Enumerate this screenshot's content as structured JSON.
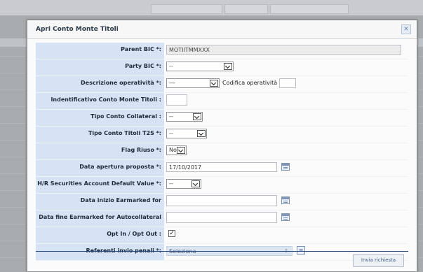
{
  "dialog": {
    "title": "Apri Conto Monte Titoli",
    "close_glyph": "✕"
  },
  "fields": {
    "parent_bic": {
      "label": "Parent BIC *:",
      "value": "MOTIITMMXXX"
    },
    "party_bic": {
      "label": "Party BIC *:",
      "value": "--"
    },
    "descrizione": {
      "label": "Descrizione operatività *:",
      "value": "---",
      "codifica_label": "Codifica operatività :",
      "codifica_value": ""
    },
    "identificativo": {
      "label": "Indentificativo Conto Monte Titoli :",
      "value": ""
    },
    "tipo_collateral": {
      "label": "Tipo Conto Collateral :",
      "value": "--"
    },
    "tipo_t2s": {
      "label": "Tipo Conto Titoli T2S *:",
      "value": "--"
    },
    "flag_riuso": {
      "label": "Flag Riuso *:",
      "value": "No"
    },
    "data_apertura": {
      "label": "Data apertura proposta *:",
      "value": "17/10/2017"
    },
    "hr_default": {
      "label": "H/R Securities Account Default Value *:",
      "value": "--"
    },
    "data_inizio": {
      "label": "Data inizio Earmarked for Autocollateral :",
      "value": ""
    },
    "data_fine": {
      "label": "Data fine Earmarked for Autocollateral :",
      "value": ""
    },
    "opt_in": {
      "label": "Opt In / Opt Out :",
      "checked": true,
      "check_glyph": "✓"
    },
    "referenti": {
      "label": "Referenti invio penali *:",
      "value": "Seleziona",
      "caret": "⇕",
      "list_glyph": "≡"
    }
  },
  "footer": {
    "submit_label": "Invia richiesta"
  },
  "icons": {
    "calendar": "calendar-icon",
    "close": "close-icon",
    "list": "list-icon"
  },
  "colors": {
    "label_bg": "#d6e3f4",
    "accent": "#3a5f93"
  }
}
